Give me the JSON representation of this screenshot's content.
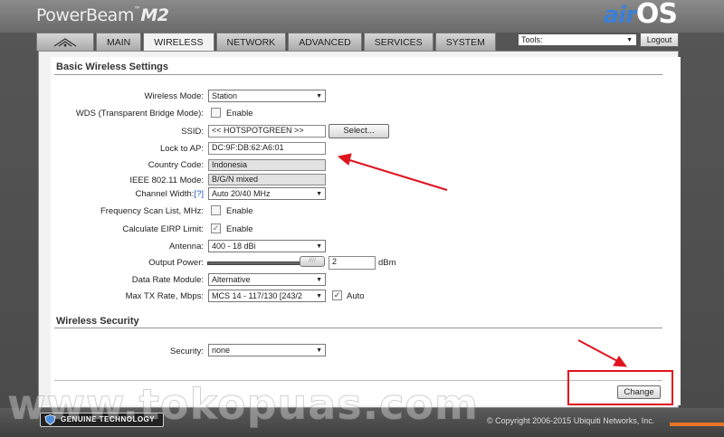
{
  "header": {
    "product_name": "PowerBeam",
    "product_tm": "™",
    "product_model": "M2",
    "os_brand_prefix": "air",
    "os_brand_suffix": "OS"
  },
  "tabs": [
    {
      "label": "",
      "icon": "ubiquiti-logo-icon"
    },
    {
      "label": "MAIN"
    },
    {
      "label": "WIRELESS",
      "active": true
    },
    {
      "label": "NETWORK"
    },
    {
      "label": "ADVANCED"
    },
    {
      "label": "SERVICES"
    },
    {
      "label": "SYSTEM"
    }
  ],
  "toolbar": {
    "tools_value": "Tools:",
    "logout_label": "Logout"
  },
  "basic": {
    "title": "Basic Wireless Settings",
    "wireless_mode_label": "Wireless Mode:",
    "wireless_mode_value": "Station",
    "wds_label": "WDS (Transparent Bridge Mode):",
    "wds_enable": "Enable",
    "ssid_label": "SSID:",
    "ssid_value": "<< HOTSPOTGREEN >>",
    "select_button": "Select...",
    "lock_label": "Lock to AP:",
    "lock_value": "DC:9F:DB:62:A6:01",
    "country_label": "Country Code:",
    "country_value": "Indonesia",
    "ieee_label": "IEEE 802.11 Mode:",
    "ieee_value": "B/G/N mixed",
    "channel_width_label": "Channel Width:",
    "channel_width_help": "[?]",
    "channel_width_value": "Auto 20/40 MHz",
    "freq_label": "Frequency Scan List, MHz:",
    "freq_enable": "Enable",
    "eirp_label": "Calculate EIRP Limit:",
    "eirp_enable": "Enable",
    "antenna_label": "Antenna:",
    "antenna_value": "400 - 18 dBi",
    "output_label": "Output Power:",
    "output_value": "2",
    "output_unit": "dBm",
    "rate_module_label": "Data Rate Module:",
    "rate_module_value": "Alternative",
    "max_tx_label": "Max TX Rate, Mbps:",
    "max_tx_value": "MCS 14 - 117/130 [243/2",
    "max_tx_auto": "Auto"
  },
  "security": {
    "title": "Wireless Security",
    "security_label": "Security:",
    "security_value": "none"
  },
  "actions": {
    "change_label": "Change"
  },
  "footer": {
    "genuine_text": "GENUINE TECHNOLOGY",
    "copyright": "© Copyright 2006-2015 Ubiquiti Networks, Inc."
  },
  "watermark": "www.tokopuas.com",
  "colors": {
    "annotation_red": "#e0141e",
    "help_link": "#2a56c6",
    "os_blue": "#3b7fd6"
  }
}
